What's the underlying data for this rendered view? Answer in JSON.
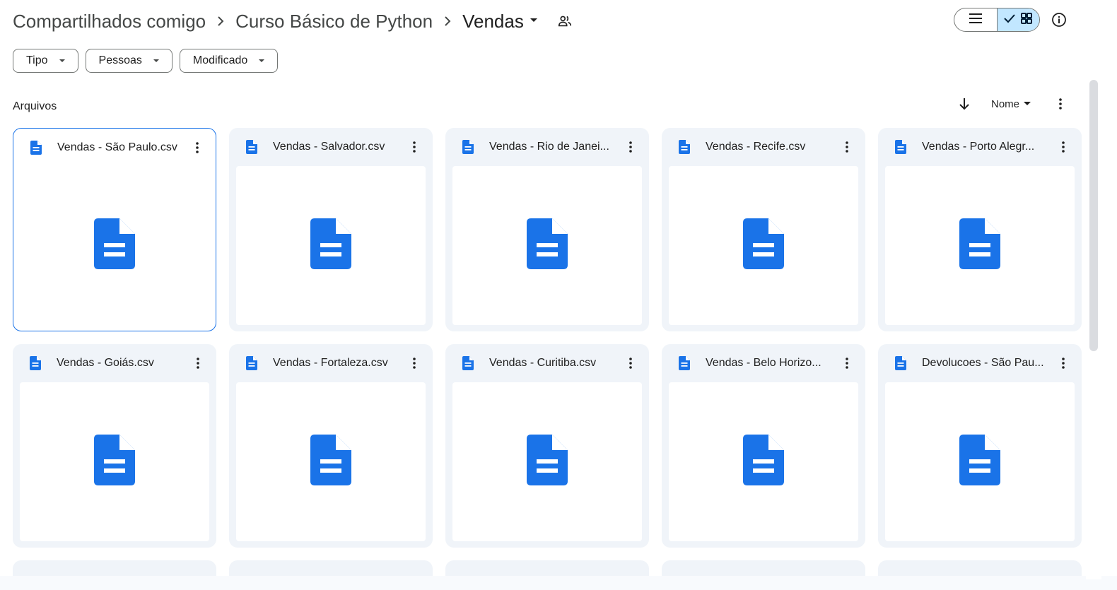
{
  "breadcrumb": {
    "items": [
      "Compartilhados comigo",
      "Curso Básico de Python"
    ],
    "current": "Vendas"
  },
  "filters": [
    {
      "label": "Tipo"
    },
    {
      "label": "Pessoas"
    },
    {
      "label": "Modificado"
    }
  ],
  "view": {
    "mode": "grid"
  },
  "section": {
    "title": "Arquivos"
  },
  "sort": {
    "field": "Nome",
    "direction": "ascending"
  },
  "files": [
    {
      "name": "Vendas - São Paulo.csv",
      "selected": true
    },
    {
      "name": "Vendas - Salvador.csv"
    },
    {
      "name": "Vendas - Rio de Janei..."
    },
    {
      "name": "Vendas - Recife.csv"
    },
    {
      "name": "Vendas - Porto Alegr..."
    },
    {
      "name": "Vendas - Goiás.csv"
    },
    {
      "name": "Vendas - Fortaleza.csv"
    },
    {
      "name": "Vendas - Curitiba.csv"
    },
    {
      "name": "Vendas - Belo Horizo..."
    },
    {
      "name": "Devolucoes - São Pau..."
    }
  ],
  "colors": {
    "accent": "#1a73e8",
    "file_icon": "#1a73e8",
    "card_bg": "#f0f4f9",
    "toggle_active": "#c2e7ff"
  },
  "icons": {
    "separator": "chevron-right-icon",
    "dropdown": "arrow-drop-down-icon",
    "share": "people-icon",
    "list_view": "list-view-icon",
    "grid_view": "grid-view-icon",
    "info": "info-icon",
    "file": "document-icon",
    "more": "more-vert-icon",
    "sort": "arrow-down-icon"
  }
}
